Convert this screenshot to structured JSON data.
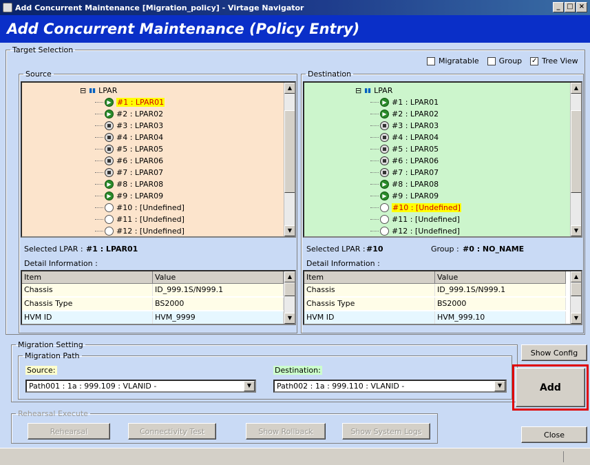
{
  "window": {
    "title": "Add Concurrent Maintenance [Migration_policy] - Virtage Navigator",
    "buttons": [
      "_",
      "□",
      "×"
    ]
  },
  "header": {
    "title": "Add Concurrent Maintenance (Policy Entry)"
  },
  "target": {
    "legend": "Target Selection",
    "checks": [
      {
        "label": "Migratable",
        "checked": false
      },
      {
        "label": "Group",
        "checked": false
      },
      {
        "label": "Tree View",
        "checked": true
      }
    ],
    "source": {
      "legend": "Source",
      "bg": "#fce4cc",
      "root": "LPAR",
      "items": [
        {
          "label": "#1 : LPAR01",
          "state": "play",
          "highlight": true
        },
        {
          "label": "#2 : LPAR02",
          "state": "play"
        },
        {
          "label": "#3 : LPAR03",
          "state": "stop"
        },
        {
          "label": "#4 : LPAR04",
          "state": "stop"
        },
        {
          "label": "#5 : LPAR05",
          "state": "stop"
        },
        {
          "label": "#6 : LPAR06",
          "state": "stop"
        },
        {
          "label": "#7 : LPAR07",
          "state": "stop"
        },
        {
          "label": "#8 : LPAR08",
          "state": "play"
        },
        {
          "label": "#9 : LPAR09",
          "state": "play"
        },
        {
          "label": "#10 : [Undefined]",
          "state": "empty"
        },
        {
          "label": "#11 : [Undefined]",
          "state": "empty"
        },
        {
          "label": "#12 : [Undefined]",
          "state": "empty"
        }
      ],
      "selected_label": "Selected LPAR :",
      "selected_value": "#1 : LPAR01",
      "detail_label": "Detail Information :",
      "cols": [
        "Item",
        "Value"
      ],
      "rows": [
        [
          "Chassis",
          "ID_999.1S/N999.1"
        ],
        [
          "Chassis Type",
          "BS2000"
        ],
        [
          "HVM ID",
          "HVM_9999"
        ]
      ]
    },
    "dest": {
      "legend": "Destination",
      "bg": "#ccf5cc",
      "root": "LPAR",
      "items": [
        {
          "label": "#1 : LPAR01",
          "state": "play"
        },
        {
          "label": "#2 : LPAR02",
          "state": "play"
        },
        {
          "label": "#3 : LPAR03",
          "state": "stop"
        },
        {
          "label": "#4 : LPAR04",
          "state": "stop"
        },
        {
          "label": "#5 : LPAR05",
          "state": "stop"
        },
        {
          "label": "#6 : LPAR06",
          "state": "stop"
        },
        {
          "label": "#7 : LPAR07",
          "state": "stop"
        },
        {
          "label": "#8 : LPAR08",
          "state": "play"
        },
        {
          "label": "#9 : LPAR09",
          "state": "play"
        },
        {
          "label": "#10 : [Undefined]",
          "state": "empty",
          "highlight": true
        },
        {
          "label": "#11 : [Undefined]",
          "state": "empty"
        },
        {
          "label": "#12 : [Undefined]",
          "state": "empty"
        }
      ],
      "selected_label": "Selected LPAR :",
      "selected_value": "#10",
      "group_label": "Group :",
      "group_value": "#0 : NO_NAME",
      "detail_label": "Detail Information :",
      "cols": [
        "Item",
        "Value"
      ],
      "rows": [
        [
          "Chassis",
          "ID_999.1S/N999.1"
        ],
        [
          "Chassis Type",
          "BS2000"
        ],
        [
          "HVM ID",
          "HVM_999.10"
        ]
      ]
    }
  },
  "migration": {
    "legend": "Migration Setting",
    "path_legend": "Migration Path",
    "source_label": "Source:",
    "dest_label": "Destination:",
    "source_path": "Path001 : 1a : 999.109 : VLANID -",
    "dest_path": "Path002 : 1a : 999.110 : VLANID -"
  },
  "rehearsal": {
    "legend": "Rehearsal Execute",
    "rehearsal": "Rehearsal",
    "connectivity": "Connectivity Test"
  },
  "buttons": {
    "show_rollback": "Show Rollback",
    "show_logs": "Show System Logs",
    "show_config": "Show Config",
    "add": "Add",
    "close": "Close"
  },
  "colors": {
    "add_highlight": "#e00000",
    "header": "#0a2fc8",
    "panel": "#c9daf5"
  }
}
